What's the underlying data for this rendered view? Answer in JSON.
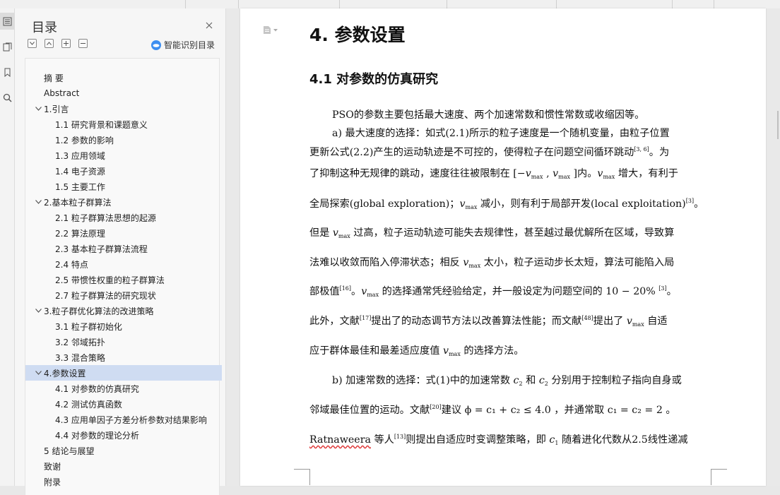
{
  "toc": {
    "title": "目录",
    "smart_label": "智能识别目录",
    "items": [
      {
        "level": 0,
        "text": "摘  要",
        "expand": false
      },
      {
        "level": 0,
        "text": "Abstract",
        "expand": false
      },
      {
        "level": 0,
        "text": "1.引言",
        "expand": true
      },
      {
        "level": 1,
        "text": "1.1  研究背景和课题意义"
      },
      {
        "level": 1,
        "text": "1.2  参数的影响"
      },
      {
        "level": 1,
        "text": "1.3  应用领域"
      },
      {
        "level": 1,
        "text": "1.4  电子资源"
      },
      {
        "level": 1,
        "text": "1.5  主要工作"
      },
      {
        "level": 0,
        "text": "2.基本粒子群算法",
        "expand": true
      },
      {
        "level": 1,
        "text": "2.1  粒子群算法思想的起源"
      },
      {
        "level": 1,
        "text": "2.2  算法原理"
      },
      {
        "level": 1,
        "text": "2.3  基本粒子群算法流程"
      },
      {
        "level": 1,
        "text": "2.4  特点"
      },
      {
        "level": 1,
        "text": "2.5  带惯性权重的粒子群算法"
      },
      {
        "level": 1,
        "text": "2.7  粒子群算法的研究现状"
      },
      {
        "level": 0,
        "text": "3.粒子群优化算法的改进策略",
        "expand": true
      },
      {
        "level": 1,
        "text": "3.1  粒子群初始化"
      },
      {
        "level": 1,
        "text": "3.2  邻域拓扑"
      },
      {
        "level": 1,
        "text": "3.3  混合策略"
      },
      {
        "level": 0,
        "text": "4.参数设置",
        "expand": true,
        "selected": true
      },
      {
        "level": 1,
        "text": "4.1  对参数的仿真研究"
      },
      {
        "level": 1,
        "text": "4.2  测试仿真函数"
      },
      {
        "level": 1,
        "text": "4.3  应用单因子方差分析参数对结果影响"
      },
      {
        "level": 1,
        "text": "4.4  对参数的理论分析"
      },
      {
        "level": 0,
        "text": "5 结论与展望"
      },
      {
        "level": 0,
        "text": "致谢"
      },
      {
        "level": 0,
        "text": "附录"
      }
    ]
  },
  "doc": {
    "heading1": "4. 参数设置",
    "heading2": "4.1  对参数的仿真研究",
    "lines": [
      {
        "indent": true,
        "parts": [
          {
            "t": "PSO的参数主要包括最大速度、两个加速常数和惯性常数或收缩因等。"
          }
        ]
      },
      {
        "indent": true,
        "parts": [
          {
            "t": "a)  最大速度的选择：如式(2.1)所示的粒子速度是一个随机变量，由粒子位置"
          }
        ]
      },
      {
        "parts": [
          {
            "t": "更新公式(2.2)产生的运动轨迹是不可控的，使得粒子在问题空间循环跳动"
          },
          {
            "sup": "[3, 6]"
          },
          {
            "t": "。为"
          }
        ]
      },
      {
        "parts": [
          {
            "t": "了抑制这种无规律的跳动，速度往往被限制在 [−"
          },
          {
            "v": "v",
            "s": "max"
          },
          {
            "t": " , "
          },
          {
            "v": "v",
            "s": "max"
          },
          {
            "t": " ]内。"
          },
          {
            "v": "v",
            "s": "max"
          },
          {
            "t": " 增大，有利于"
          }
        ]
      },
      {
        "parts": [
          {
            "t": "全局探索(global exploration)；"
          },
          {
            "v": "v",
            "s": "max"
          },
          {
            "t": " 减小，则有利于局部开发(local exploitation)"
          },
          {
            "sup": "[3]"
          },
          {
            "t": "。"
          }
        ]
      },
      {
        "parts": [
          {
            "t": "但是 "
          },
          {
            "v": "v",
            "s": "max"
          },
          {
            "t": " 过高，粒子运动轨迹可能失去规律性，甚至越过最优解所在区域，导致算"
          }
        ]
      },
      {
        "parts": [
          {
            "t": "法难以收敛而陷入停滞状态；相反 "
          },
          {
            "v": "v",
            "s": "max"
          },
          {
            "t": " 太小，粒子运动步长太短，算法可能陷入局"
          }
        ]
      },
      {
        "parts": [
          {
            "t": "部极值"
          },
          {
            "sup": "[16]"
          },
          {
            "t": "。"
          },
          {
            "v": "v",
            "s": "max"
          },
          {
            "t": " 的选择通常凭经验给定，并一般设定为问题空间的 10 − 20%  "
          },
          {
            "sup": "[3]"
          },
          {
            "t": "。"
          }
        ]
      },
      {
        "parts": [
          {
            "t": "此外，文献"
          },
          {
            "sup": "[17]"
          },
          {
            "t": "提出了的动态调节方法以改善算法性能；而文献"
          },
          {
            "sup": "[48]"
          },
          {
            "t": "提出了 "
          },
          {
            "v": "v",
            "s": "max"
          },
          {
            "t": " 自适"
          }
        ]
      },
      {
        "parts": [
          {
            "t": "应于群体最佳和最差适应度值 "
          },
          {
            "v": "v",
            "s": "max"
          },
          {
            "t": " 的选择方法。"
          }
        ]
      },
      {
        "indent": true,
        "parts": [
          {
            "t": "b)  加速常数的选择：式(1)中的加速常数 "
          },
          {
            "v": "c",
            "s": "2"
          },
          {
            "t": " 和 "
          },
          {
            "v": "c",
            "s": "2"
          },
          {
            "t": " 分别用于控制粒子指向自身或"
          }
        ]
      },
      {
        "parts": [
          {
            "t": "邻域最佳位置的运动。文献"
          },
          {
            "sup": "[20]"
          },
          {
            "t": "建议 ϕ = c₁ + c₂ ≤ 4.0 ，并通常取 c₁ = c₂ = 2 。"
          }
        ]
      },
      {
        "parts": [
          {
            "t": "Ratnaweera",
            "sq": true
          },
          {
            "t": "  等人"
          },
          {
            "sup": "[13]"
          },
          {
            "t": "则提出自适应时变调整策略，即 "
          },
          {
            "v": "c",
            "s": "1"
          },
          {
            "t": " 随着进化代数从2.5线性递减"
          }
        ]
      }
    ]
  }
}
